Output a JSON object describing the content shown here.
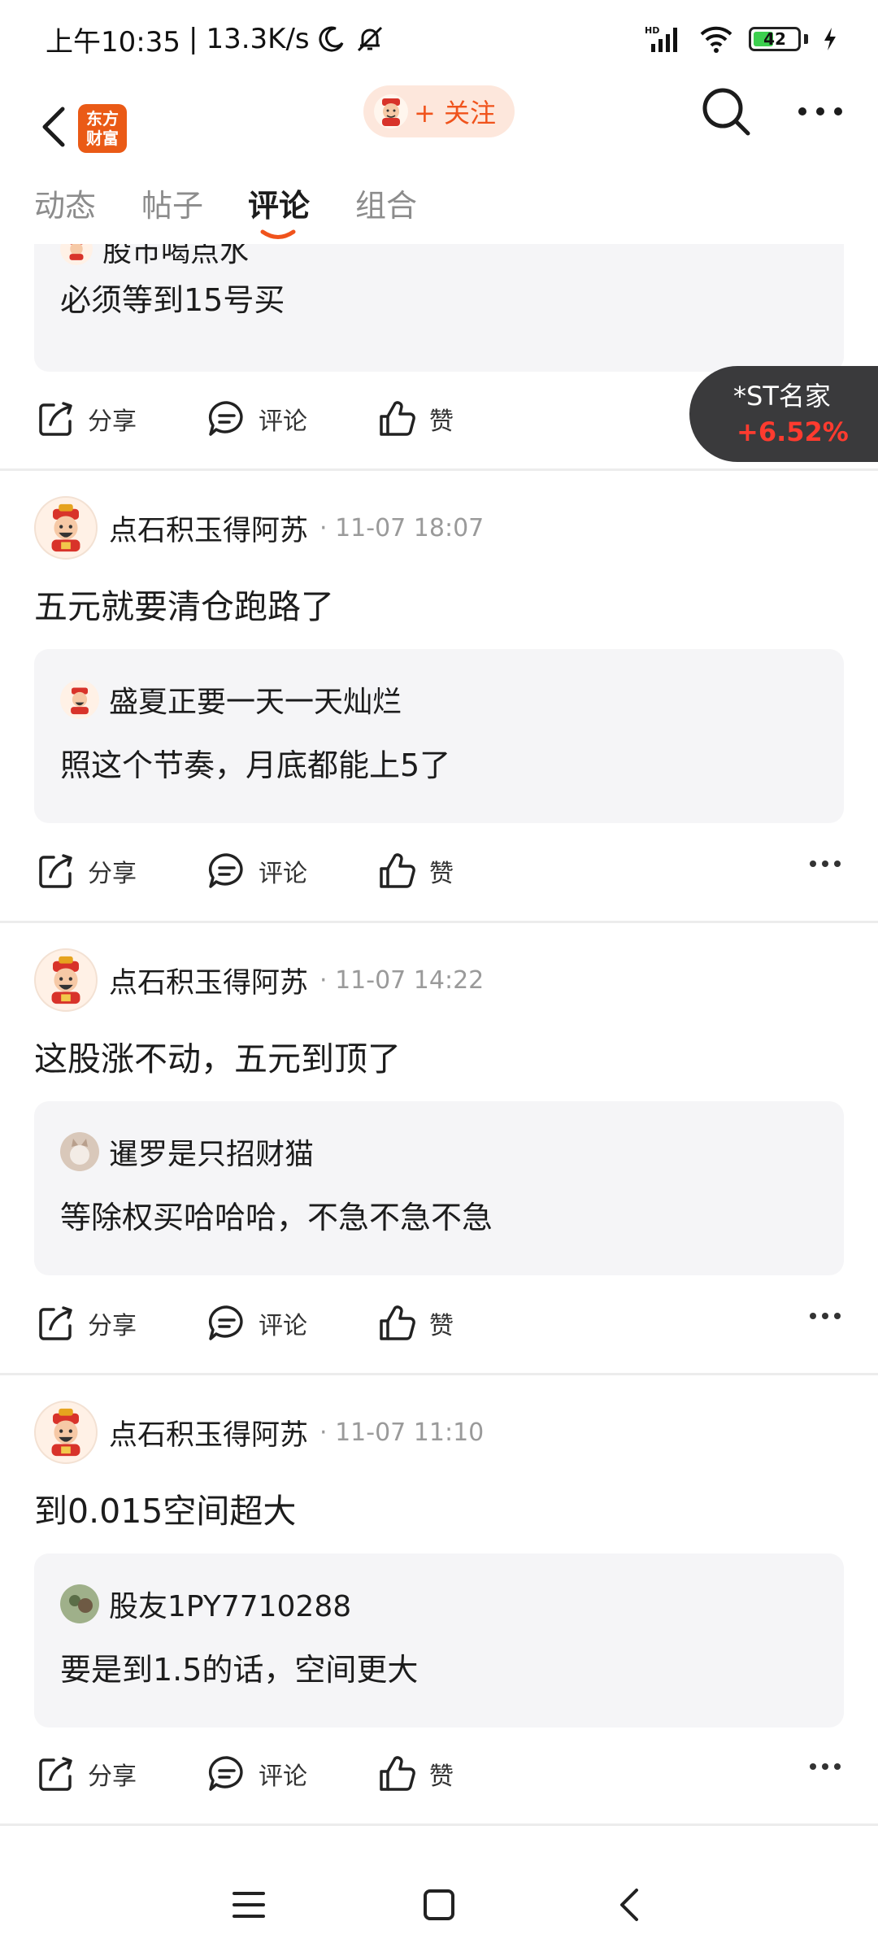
{
  "status_bar": {
    "time": "上午10:35",
    "separator": "|",
    "net_speed": "13.3K/s",
    "battery": "42",
    "network": "HD"
  },
  "header": {
    "logo_line1": "东方",
    "logo_line2": "财富",
    "follow_label": "+ 关注"
  },
  "tabs": [
    "动态",
    "帖子",
    "评论",
    "组合"
  ],
  "active_tab": "评论",
  "stock_badge": {
    "name": "*ST名家",
    "change": "+6.52%"
  },
  "first_item": {
    "partial_user": "股市喝点水",
    "quote_text": "必须等到15号买"
  },
  "posts": [
    {
      "user": "点石积玉得阿苏",
      "time": "· 11-07 18:07",
      "text": "五元就要清仓跑路了",
      "quote_user": "盛夏正要一天一天灿烂",
      "quote_text": "照这个节奏，月底都能上5了"
    },
    {
      "user": "点石积玉得阿苏",
      "time": "· 11-07 14:22",
      "text": "这股涨不动，五元到顶了",
      "quote_user": "暹罗是只招财猫",
      "quote_text": "等除权买哈哈哈，不急不急不急"
    },
    {
      "user": "点石积玉得阿苏",
      "time": "· 11-07 11:10",
      "text": "到0.015空间超大",
      "quote_user": "股友1PY7710288",
      "quote_text": "要是到1.5的话，空间更大"
    }
  ],
  "actions": {
    "share": "分享",
    "comment": "评论",
    "like": "赞"
  },
  "colors": {
    "brand": "#ea5a16",
    "follow_bg": "#fde7dc",
    "follow_text": "#f0531c",
    "up_red": "#ff3b2f",
    "badge_bg": "#3a3a3c",
    "quote_bg": "#f5f5f7"
  }
}
